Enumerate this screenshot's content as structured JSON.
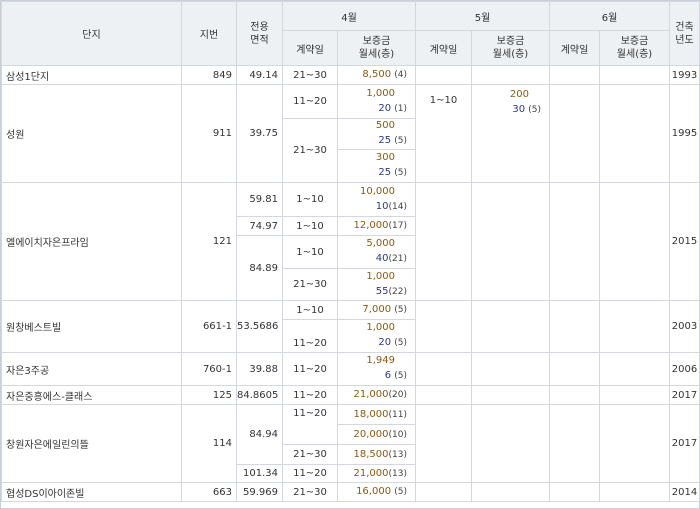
{
  "header": {
    "complex": "단지",
    "lot": "지번",
    "area": "전용\n면적",
    "built": "건축\n년도",
    "months": [
      "4월",
      "5월",
      "6월"
    ],
    "contract_day": "계약일",
    "deposit_rent": "보증금\n월세(층)"
  },
  "rows": [
    {
      "name": "삼성1단지",
      "lot": "849",
      "area": "49.14",
      "built": "1993",
      "day": "21~30",
      "dep": "8,500",
      "floor": "(4)"
    },
    {
      "name": "성원",
      "lot": "911",
      "area": "39.75",
      "built": "1995",
      "apr": [
        {
          "day": "11~20",
          "dep": "1,000",
          "rent": "20",
          "floor": "(1)"
        },
        {
          "day": "21~30",
          "dep": "500",
          "rent": "25",
          "floor": "(5)"
        },
        {
          "dep": "300",
          "rent": "25",
          "floor": "(5)"
        }
      ],
      "may": {
        "day": "1~10",
        "dep": "200",
        "rent": "30",
        "floor": "(5)"
      }
    },
    {
      "name": "엘에이치자은프라임",
      "lot": "121",
      "built": "2015",
      "a1": {
        "area": "59.81",
        "day": "1~10",
        "dep": "10,000",
        "rent": "10",
        "floor": "(14)"
      },
      "a2": {
        "area": "74.97",
        "day": "1~10",
        "dep": "12,000",
        "floor": "(17)"
      },
      "a3": {
        "area": "84.89",
        "r1": {
          "day": "1~10",
          "dep": "5,000",
          "rent": "40",
          "floor": "(21)"
        },
        "r2": {
          "day": "21~30",
          "dep": "1,000",
          "rent": "55",
          "floor": "(22)"
        }
      }
    },
    {
      "name": "원창베스트빌",
      "lot": "661-1",
      "area": "53.5686",
      "built": "2003",
      "r1": {
        "day": "1~10",
        "dep": "7,000",
        "floor": "(5)"
      },
      "r2": {
        "day": "11~20",
        "dep": "1,000",
        "rent": "20",
        "floor": "(5)"
      }
    },
    {
      "name": "자은3주공",
      "lot": "760-1",
      "area": "39.88",
      "built": "2006",
      "day": "11~20",
      "dep": "1,949",
      "rent": "6",
      "floor": "(5)"
    },
    {
      "name": "자은중흥에스-클래스",
      "lot": "125",
      "area": "84.8605",
      "built": "2017",
      "day": "11~20",
      "dep": "21,000",
      "floor": "(20)"
    },
    {
      "name": "창원자은에일린의뜰",
      "lot": "114",
      "built": "2017",
      "a1": {
        "area": "84.94",
        "r1": {
          "day": "11~20",
          "dep": "18,000",
          "floor": "(11)"
        },
        "r2": {
          "dep": "20,000",
          "floor": "(10)"
        },
        "r3": {
          "day": "21~30",
          "dep": "18,500",
          "floor": "(13)"
        }
      },
      "a2": {
        "area": "101.34",
        "day": "11~20",
        "dep": "21,000",
        "floor": "(13)"
      }
    },
    {
      "name": "협성DS이아이존빌",
      "lot": "663",
      "area": "59.969",
      "built": "2014",
      "day": "21~30",
      "dep": "16,000",
      "floor": "(5)"
    }
  ]
}
